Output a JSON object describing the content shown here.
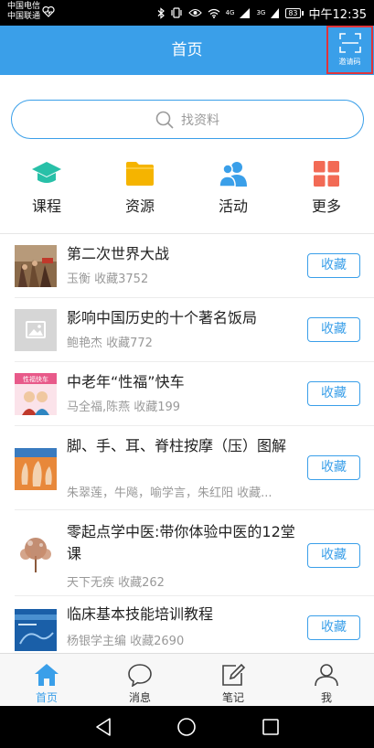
{
  "status_bar": {
    "carrier_line1": "中国电信",
    "carrier_line2": "中国联通",
    "signal1": "4G",
    "signal2": "3G",
    "battery": "83",
    "time": "中午12:35"
  },
  "header": {
    "title": "首页",
    "invite_label": "邀请码",
    "invite_icon": "scan-icon"
  },
  "search": {
    "placeholder": "找资料",
    "icon": "search-icon"
  },
  "quick_nav": [
    {
      "label": "课程",
      "icon": "graduation-cap-icon",
      "color": "#28c0a8"
    },
    {
      "label": "资源",
      "icon": "folder-icon",
      "color": "#f5b400"
    },
    {
      "label": "活动",
      "icon": "people-icon",
      "color": "#3a9fe9"
    },
    {
      "label": "更多",
      "icon": "grid-icon",
      "color": "#f26a55"
    }
  ],
  "books": [
    {
      "title": "第二次世界大战",
      "meta": "玉衡 收藏3752",
      "button": "收藏"
    },
    {
      "title": "影响中国历史的十个著名饭局",
      "meta": "鲍艳杰 收藏772",
      "button": "收藏"
    },
    {
      "title": "中老年“性福”快车",
      "meta": "马全福,陈燕 收藏199",
      "button": "收藏",
      "cover_text": "性福快车"
    },
    {
      "title": "脚、手、耳、脊柱按摩（压）图解",
      "meta": "朱翠莲，牛飚，喻学言，朱红阳 收藏...",
      "button": "收藏"
    },
    {
      "title": "零起点学中医:带你体验中医的12堂课",
      "meta": "天下无疾 收藏262",
      "button": "收藏"
    },
    {
      "title": "临床基本技能培训教程",
      "meta": "杨银学主编 收藏2690",
      "button": "收藏"
    }
  ],
  "tab_bar": [
    {
      "label": "首页",
      "icon": "home-icon",
      "active": true
    },
    {
      "label": "消息",
      "icon": "message-icon",
      "active": false
    },
    {
      "label": "笔记",
      "icon": "note-edit-icon",
      "active": false
    },
    {
      "label": "我",
      "icon": "user-icon",
      "active": false
    }
  ],
  "colors": {
    "accent": "#3a9fe9",
    "highlight_border": "#e0343b"
  }
}
